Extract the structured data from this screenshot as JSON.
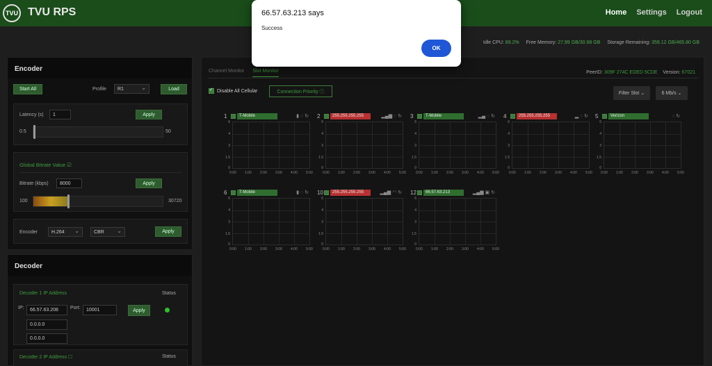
{
  "header": {
    "logo_text": "TVU",
    "brand": "TVU RPS",
    "nav": [
      "Home",
      "Settings",
      "Logout"
    ]
  },
  "stats": {
    "idle_cpu_label": "Idle CPU:",
    "idle_cpu": "89.2%",
    "free_mem_label": "Free Memory:",
    "free_mem": "27.99 GB/30.98 GB",
    "storage_label": "Storage Remaining:",
    "storage": "359.12 GB/465.80 GB"
  },
  "encoder": {
    "title": "Encoder",
    "start_all": "Start All",
    "profile_label": "Profile",
    "profile_value": "R1",
    "load": "Load",
    "latency_label": "Latency (s)",
    "latency_value": "1",
    "apply": "Apply",
    "latency_min": "0.5",
    "latency_max": "50",
    "global_bitrate": "Global Bitrate Value",
    "bitrate_label": "Bitrate (kbps)",
    "bitrate_value": "8000",
    "bitrate_min": "100",
    "bitrate_max": "30720",
    "encoder_label": "Encoder",
    "codec": "H.264",
    "rate_mode": "CBR"
  },
  "decoder": {
    "title": "Decoder",
    "d1_label": "Decoder 1 IP Address",
    "status": "Status",
    "ip_label": "IP:",
    "ip1": "66.57.63.208",
    "port_label": "Port:",
    "port": "10001",
    "apply": "Apply",
    "ip2": "0.0.0.0",
    "ip3": "0.0.0.0",
    "d2_label": "Decoder 2 IP Address",
    "status_color": "#2fbf2f"
  },
  "main": {
    "tabs": [
      "Channel Monitor",
      "Slot Monitor"
    ],
    "peer_label": "PeerID:",
    "peer_id": "309F 274C EDED 5CDE",
    "version_label": "Version:",
    "version": "67021",
    "disable_cellular": "Disable All Cellular",
    "connection_priority": "Connection Priority ⓘ",
    "filter_slot": "Filter Slot ⌄",
    "rate": "6 Mb/s ⌄"
  },
  "slots": [
    {
      "num": "1",
      "carrier": "T-Mobile",
      "status": "green",
      "icons": "▮ ◌ ↻"
    },
    {
      "num": "2",
      "carrier": "255.255.255.255",
      "status": "red",
      "icons": "▂▄▆ ◌ ↻"
    },
    {
      "num": "3",
      "carrier": "T-Mobile",
      "status": "green",
      "icons": "▂▄ ◌ ↻"
    },
    {
      "num": "4",
      "carrier": "255.255.255.255",
      "status": "red",
      "icons": "▂ ◌ ↻"
    },
    {
      "num": "5",
      "carrier": "Verizon",
      "status": "green",
      "icons": "◌ ↻"
    },
    {
      "num": "6",
      "carrier": "T-Mobile",
      "status": "green",
      "icons": "▮ ◌ ↻"
    },
    {
      "num": "10",
      "carrier": "255.255.255.255",
      "status": "red",
      "icons": "▂▄▆ ◠ ↻"
    },
    {
      "num": "12",
      "carrier": "66.57.63.213",
      "status": "green",
      "icons": "▂▄▆ ▣ ↻"
    }
  ],
  "plot": {
    "yticks": [
      "6",
      "4",
      "3",
      "1.5",
      "0"
    ],
    "xticks": [
      "0:00",
      "1:00",
      "2:00",
      "3:00",
      "4:00",
      "5:00"
    ]
  },
  "dialog": {
    "title": "66.57.63.213 says",
    "message": "Success",
    "ok": "OK"
  }
}
